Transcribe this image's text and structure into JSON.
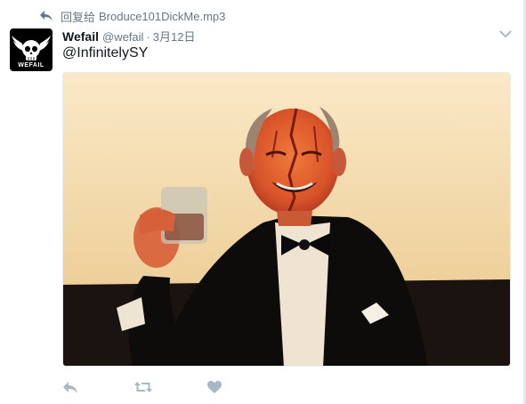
{
  "reply_context": {
    "prefix": "回复给",
    "target": "Broduce101DickMe.mp3"
  },
  "tweet": {
    "fullname": "Wefail",
    "username": "@wefail",
    "separator": "·",
    "timestamp": "3月12日",
    "text": "@InfinitelySY"
  },
  "avatar": {
    "logo_text": "WEFAIL"
  },
  "media": {
    "description": "photo"
  },
  "icons": {
    "reply_context": "reply-arrow-icon",
    "caret": "chevron-down-icon",
    "reply": "reply-icon",
    "retweet": "retweet-icon",
    "like": "heart-icon"
  },
  "colors": {
    "text": "#14171a",
    "secondary": "#657786",
    "action": "#aab8c2",
    "border": "#e1e8ed"
  }
}
